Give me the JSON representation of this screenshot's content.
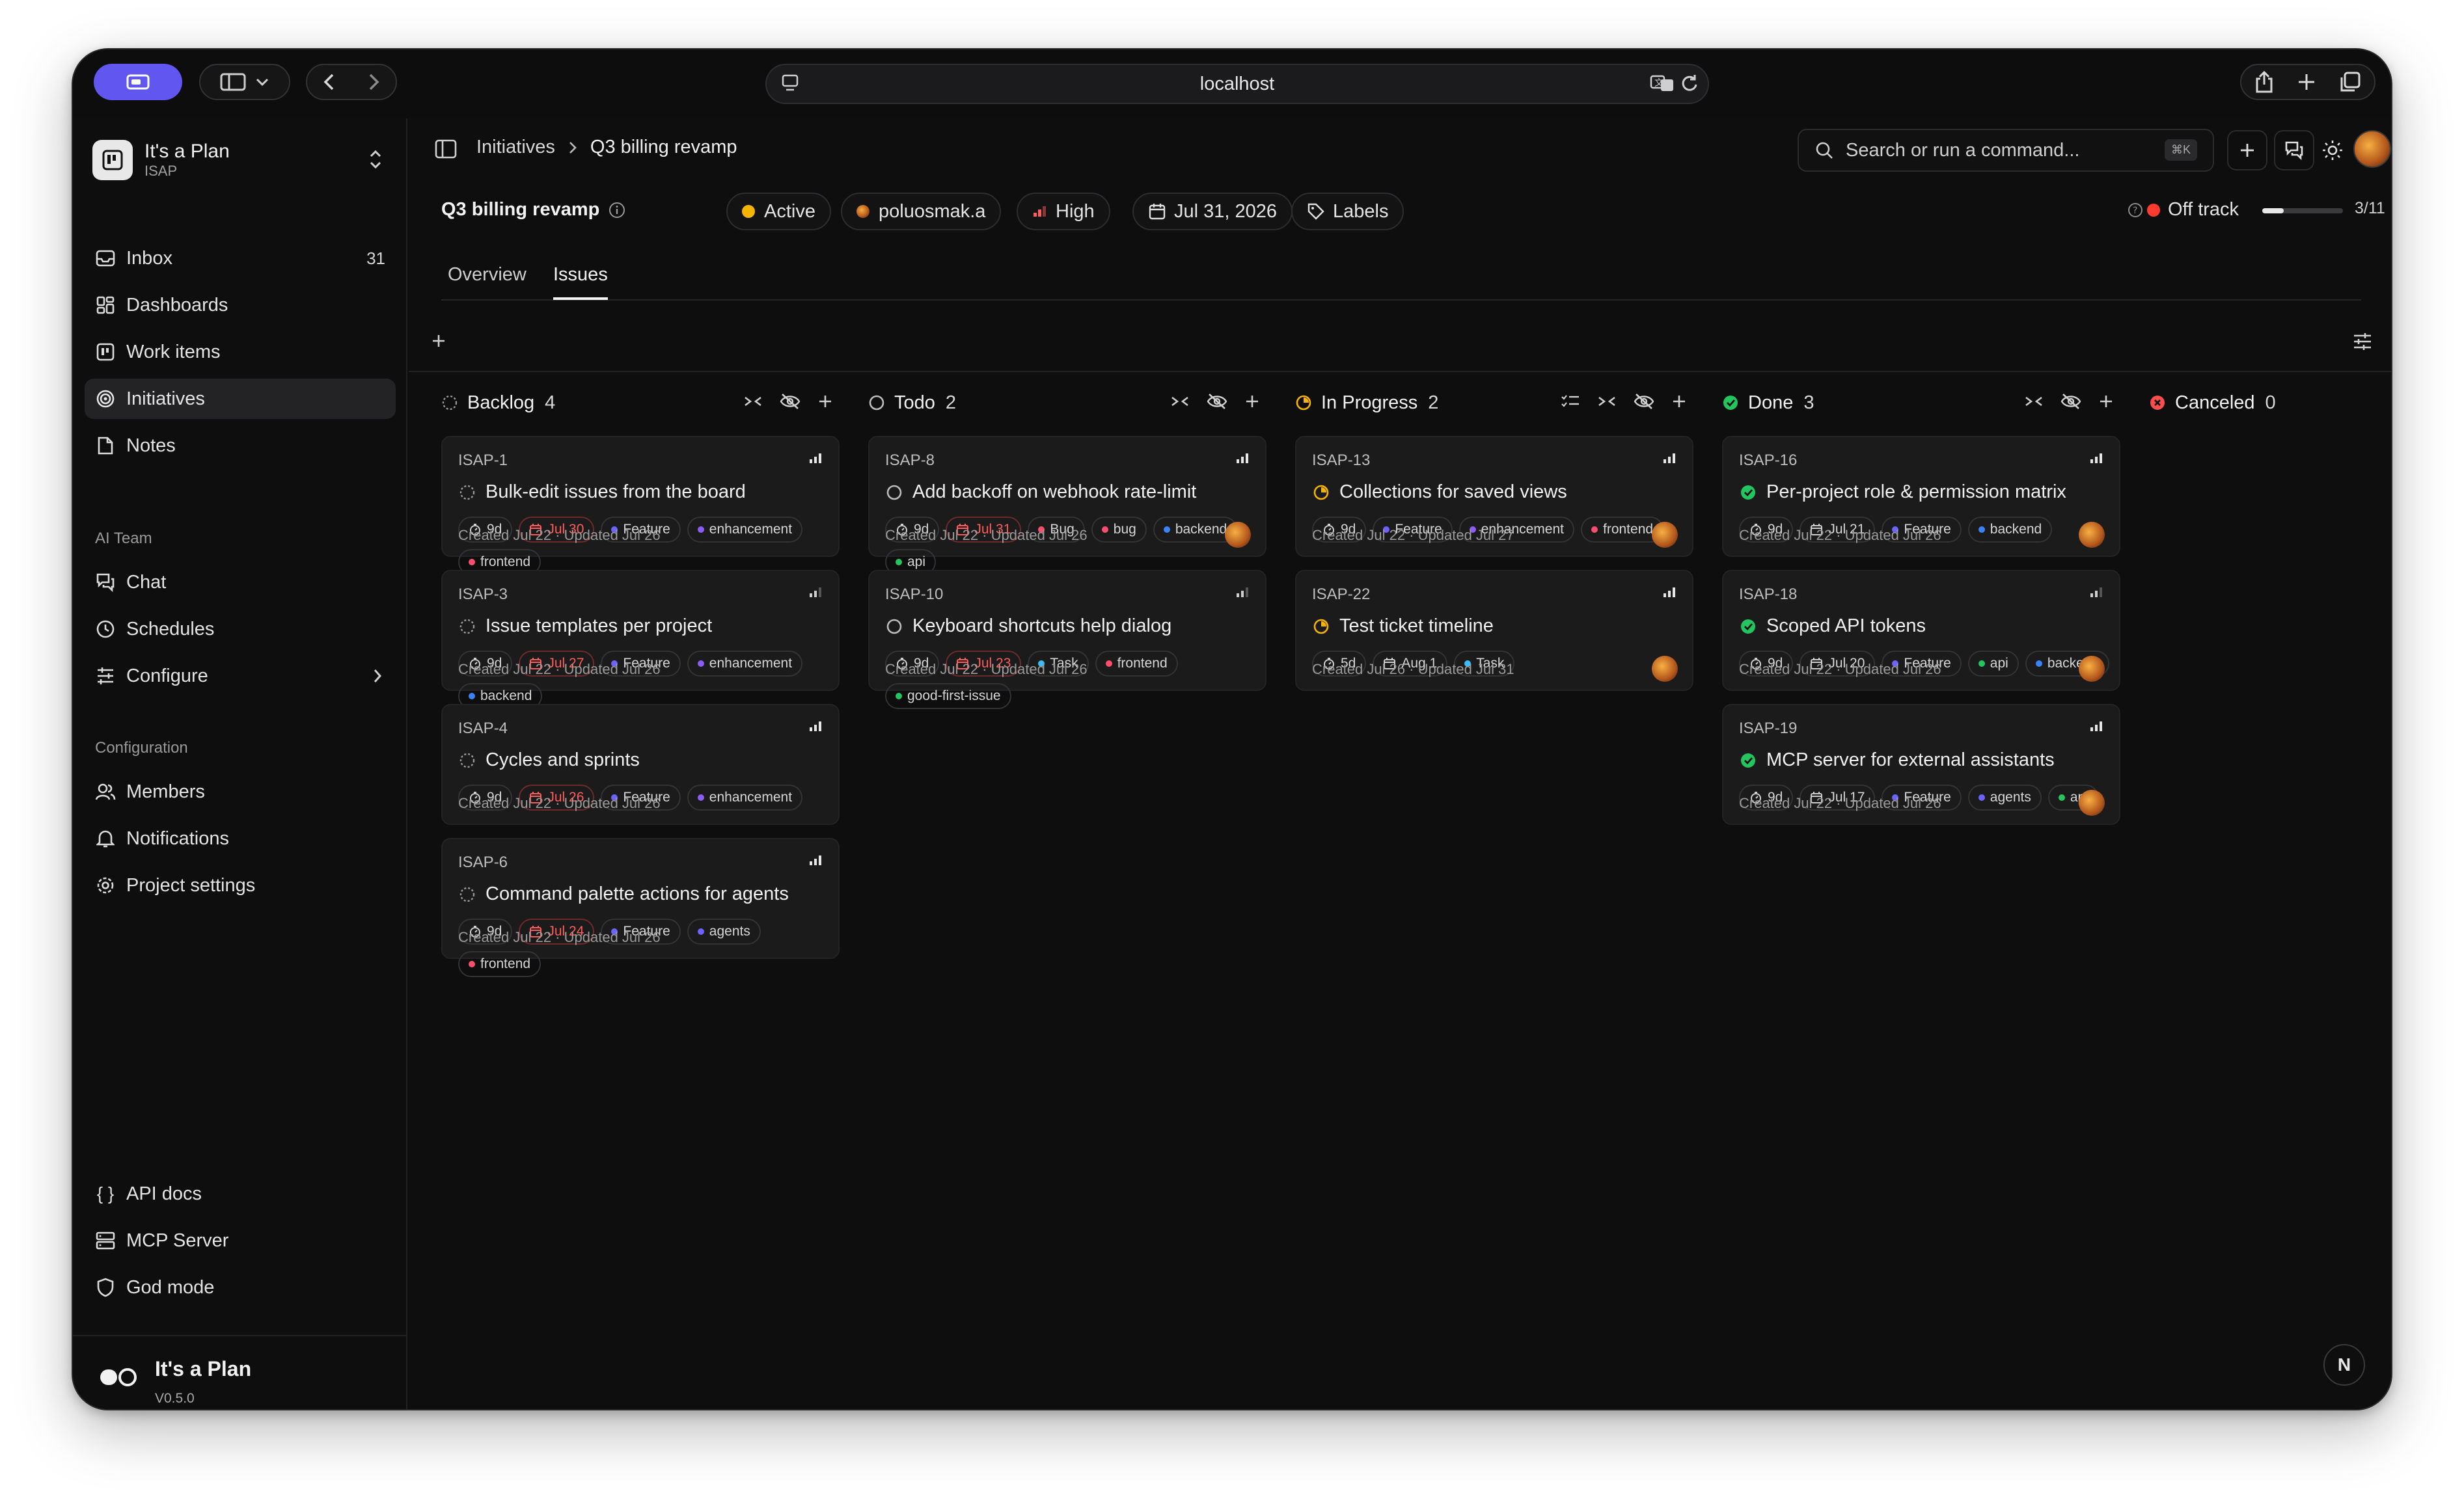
{
  "browser": {
    "url": "localhost"
  },
  "workspace": {
    "name": "It's a Plan",
    "key": "ISAP"
  },
  "sidebar": {
    "items": [
      {
        "label": "Inbox",
        "count": "31"
      },
      {
        "label": "Dashboards"
      },
      {
        "label": "Work items"
      },
      {
        "label": "Initiatives"
      },
      {
        "label": "Notes"
      }
    ],
    "ai_header": "AI Team",
    "ai_items": [
      {
        "label": "Chat"
      },
      {
        "label": "Schedules"
      },
      {
        "label": "Configure"
      }
    ],
    "config_header": "Configuration",
    "config_items": [
      {
        "label": "Members"
      },
      {
        "label": "Notifications"
      },
      {
        "label": "Project settings"
      }
    ],
    "bottom_items": [
      {
        "label": "API docs"
      },
      {
        "label": "MCP Server"
      },
      {
        "label": "God mode"
      }
    ],
    "footer": {
      "name": "It's a Plan",
      "version": "V0.5.0"
    }
  },
  "breadcrumb": {
    "root": "Initiatives",
    "current": "Q3 billing revamp"
  },
  "search": {
    "placeholder": "Search or run a command...",
    "shortcut": "⌘K"
  },
  "project": {
    "title": "Q3 billing revamp",
    "status": "Active",
    "status_color": "#f5b400",
    "owner": "poluosmak.a",
    "priority": "High",
    "due": "Jul 31, 2026",
    "labels": "Labels",
    "health": "Off track",
    "health_color": "#ff3b30",
    "progress_text": "3/11",
    "progress_fraction": 0.27
  },
  "tabs": [
    {
      "label": "Overview"
    },
    {
      "label": "Issues"
    }
  ],
  "columns": [
    {
      "name": "Backlog",
      "count": "4",
      "cards": [
        {
          "id": "ISAP-1",
          "title": "Bulk-edit issues from the board",
          "est": "9d",
          "due": "Jul 30",
          "tags": [
            {
              "label": "Feature",
              "color": "#6c63ff"
            },
            {
              "label": "enhancement",
              "color": "#8b5cf6"
            },
            {
              "label": "frontend",
              "color": "#ff4d6d"
            }
          ],
          "meta": "Created Jul 22 · Updated Jul 26"
        },
        {
          "id": "ISAP-3",
          "title": "Issue templates per project",
          "est": "9d",
          "due": "Jul 27",
          "tags": [
            {
              "label": "Feature",
              "color": "#6c63ff"
            },
            {
              "label": "enhancement",
              "color": "#8b5cf6"
            },
            {
              "label": "backend",
              "color": "#3b82f6"
            }
          ],
          "meta": "Created Jul 22 · Updated Jul 26"
        },
        {
          "id": "ISAP-4",
          "title": "Cycles and sprints",
          "est": "9d",
          "due": "Jul 26",
          "tags": [
            {
              "label": "Feature",
              "color": "#6c63ff"
            },
            {
              "label": "enhancement",
              "color": "#8b5cf6"
            }
          ],
          "meta": "Created Jul 22 · Updated Jul 26"
        },
        {
          "id": "ISAP-6",
          "title": "Command palette actions for agents",
          "est": "9d",
          "due": "Jul 24",
          "tags": [
            {
              "label": "Feature",
              "color": "#6c63ff"
            },
            {
              "label": "agents",
              "color": "#6c63ff"
            },
            {
              "label": "frontend",
              "color": "#ff4d6d"
            }
          ],
          "meta": "Created Jul 22 · Updated Jul 26"
        }
      ]
    },
    {
      "name": "Todo",
      "count": "2",
      "cards": [
        {
          "id": "ISAP-8",
          "title": "Add backoff on webhook rate-limit",
          "est": "9d",
          "due": "Jul 31",
          "tags": [
            {
              "label": "Bug",
              "color": "#ff4d6d"
            },
            {
              "label": "bug",
              "color": "#ff4d6d"
            },
            {
              "label": "backend",
              "color": "#3b82f6"
            },
            {
              "label": "api",
              "color": "#22c55e"
            }
          ],
          "meta": "Created Jul 22 · Updated Jul 26"
        },
        {
          "id": "ISAP-10",
          "title": "Keyboard shortcuts help dialog",
          "est": "9d",
          "due": "Jul 23",
          "tags": [
            {
              "label": "Task",
              "color": "#38bdf8"
            },
            {
              "label": "frontend",
              "color": "#ff4d6d"
            },
            {
              "label": "good-first-issue",
              "color": "#22c55e"
            }
          ],
          "meta": "Created Jul 22 · Updated Jul 26"
        }
      ]
    },
    {
      "name": "In Progress",
      "count": "2",
      "cards": [
        {
          "id": "ISAP-13",
          "title": "Collections for saved views",
          "est": "9d",
          "due": "",
          "tags": [
            {
              "label": "Feature",
              "color": "#6c63ff"
            },
            {
              "label": "enhancement",
              "color": "#8b5cf6"
            },
            {
              "label": "frontend",
              "color": "#ff4d6d"
            }
          ],
          "meta": "Created Jul 22 · Updated Jul 27"
        },
        {
          "id": "ISAP-22",
          "title": "Test ticket timeline",
          "est": "5d",
          "due": "Aug 1",
          "tags": [
            {
              "label": "Task",
              "color": "#38bdf8"
            }
          ],
          "meta": "Created Jul 26 · Updated Jul 31"
        }
      ]
    },
    {
      "name": "Done",
      "count": "3",
      "cards": [
        {
          "id": "ISAP-16",
          "title": "Per-project role & permission matrix",
          "est": "9d",
          "due": "Jul 21",
          "tags": [
            {
              "label": "Feature",
              "color": "#6c63ff"
            },
            {
              "label": "backend",
              "color": "#3b82f6"
            }
          ],
          "meta": "Created Jul 22 · Updated Jul 26"
        },
        {
          "id": "ISAP-18",
          "title": "Scoped API tokens",
          "est": "9d",
          "due": "Jul 20",
          "tags": [
            {
              "label": "Feature",
              "color": "#6c63ff"
            },
            {
              "label": "api",
              "color": "#22c55e"
            },
            {
              "label": "backend",
              "color": "#3b82f6"
            }
          ],
          "meta": "Created Jul 22 · Updated Jul 26"
        },
        {
          "id": "ISAP-19",
          "title": "MCP server for external assistants",
          "est": "9d",
          "due": "Jul 17",
          "tags": [
            {
              "label": "Feature",
              "color": "#6c63ff"
            },
            {
              "label": "agents",
              "color": "#6c63ff"
            },
            {
              "label": "api",
              "color": "#22c55e"
            }
          ],
          "meta": "Created Jul 22 · Updated Jul 26"
        }
      ]
    },
    {
      "name": "Canceled",
      "count": "0",
      "cards": []
    }
  ],
  "badge": "N"
}
